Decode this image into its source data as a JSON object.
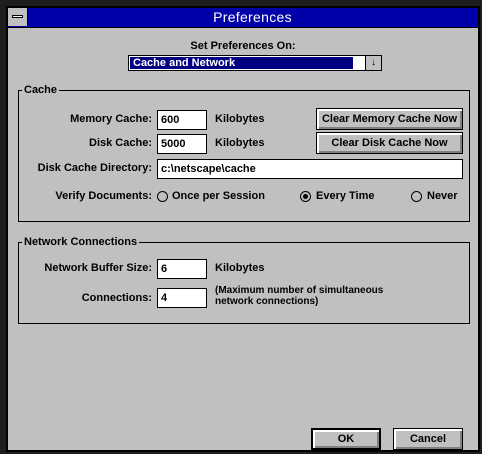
{
  "window": {
    "title": "Preferences"
  },
  "selector": {
    "label": "Set Preferences On:",
    "value": "Cache and Network",
    "arrow": "↓"
  },
  "cache": {
    "legend": "Cache",
    "memory_label": "Memory Cache:",
    "memory_value": "600",
    "memory_unit": "Kilobytes",
    "clear_memory_label": "Clear Memory Cache Now",
    "disk_label": "Disk Cache:",
    "disk_value": "5000",
    "disk_unit": "Kilobytes",
    "clear_disk_label": "Clear Disk Cache Now",
    "dir_label": "Disk Cache Directory:",
    "dir_value": "c:\\netscape\\cache",
    "verify_label": "Verify Documents:",
    "verify_options": [
      {
        "label": "Once per Session",
        "selected": false
      },
      {
        "label": "Every Time",
        "selected": true
      },
      {
        "label": "Never",
        "selected": false
      }
    ]
  },
  "network": {
    "legend": "Network Connections",
    "buffer_label": "Network Buffer Size:",
    "buffer_value": "6",
    "buffer_unit": "Kilobytes",
    "connections_label": "Connections:",
    "connections_value": "4",
    "connections_note_line1": "(Maximum number of simultaneous",
    "connections_note_line2": "network connections)"
  },
  "buttons": {
    "ok": "OK",
    "cancel": "Cancel"
  }
}
